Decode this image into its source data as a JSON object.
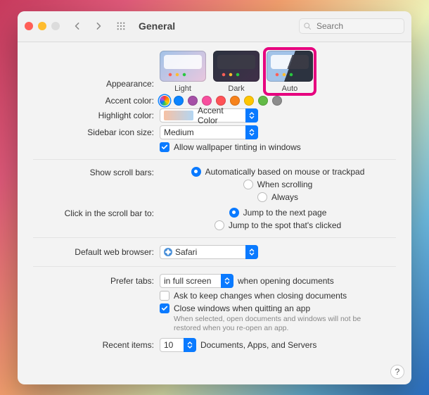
{
  "window": {
    "title": "General"
  },
  "search": {
    "placeholder": "Search"
  },
  "labels": {
    "appearance": "Appearance:",
    "accent": "Accent color:",
    "highlight": "Highlight color:",
    "sidebar": "Sidebar icon size:",
    "scrollbars": "Show scroll bars:",
    "clickscroll": "Click in the scroll bar to:",
    "browser": "Default web browser:",
    "prefertabs": "Prefer tabs:",
    "recent": "Recent items:"
  },
  "appearance": {
    "options": [
      {
        "key": "light",
        "label": "Light"
      },
      {
        "key": "dark",
        "label": "Dark"
      },
      {
        "key": "auto",
        "label": "Auto"
      }
    ],
    "selected": "auto"
  },
  "accent_colors": [
    "#0a84ff",
    "#a550a7",
    "#f74f9e",
    "#ff5257",
    "#f7821b",
    "#ffc600",
    "#62ba46",
    "#8c8c8c"
  ],
  "highlight_select": "Accent Color",
  "sidebar_select": "Medium",
  "wallpaper_tint": {
    "checked": true,
    "label": "Allow wallpaper tinting in windows"
  },
  "scrollbars": {
    "selected": 0,
    "options": [
      "Automatically based on mouse or trackpad",
      "When scrolling",
      "Always"
    ]
  },
  "clickscroll": {
    "selected": 0,
    "options": [
      "Jump to the next page",
      "Jump to the spot that's clicked"
    ]
  },
  "browser_select": "Safari",
  "prefer_tabs": {
    "value": "in full screen",
    "suffix": "when opening documents"
  },
  "ask_keep": {
    "checked": false,
    "label": "Ask to keep changes when closing documents"
  },
  "close_windows": {
    "checked": true,
    "label": "Close windows when quitting an app",
    "desc": "When selected, open documents and windows will not be restored when you re-open an app."
  },
  "recent": {
    "value": "10",
    "suffix": "Documents, Apps, and Servers"
  },
  "help": "?"
}
